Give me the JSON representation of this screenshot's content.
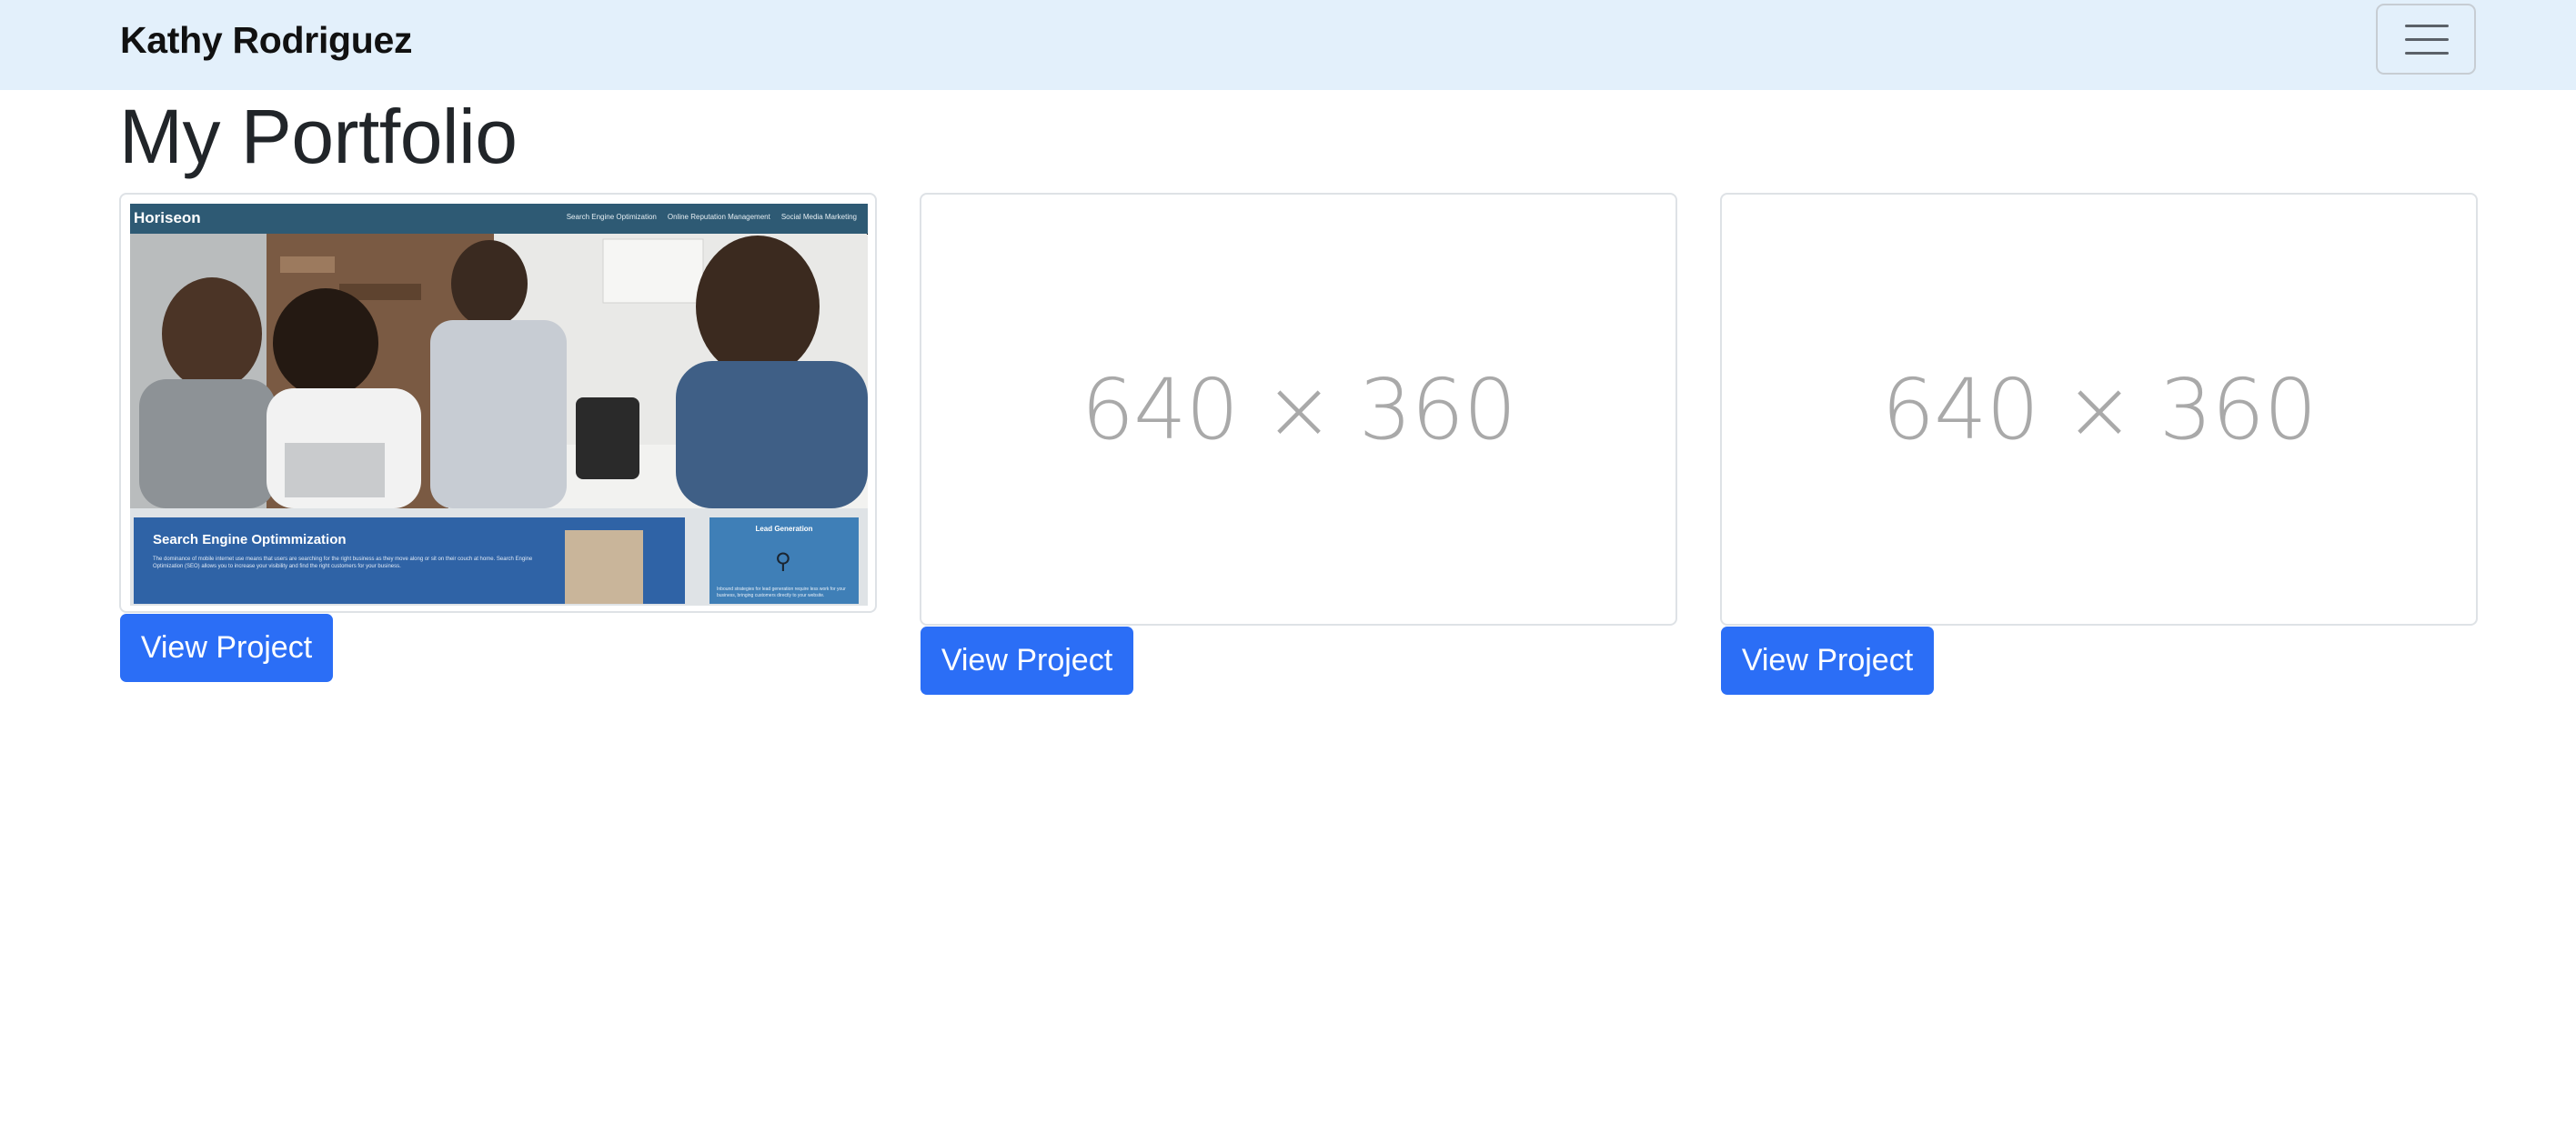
{
  "navbar": {
    "brand": "Kathy Rodriguez",
    "toggler_icon": "hamburger-menu-icon"
  },
  "page": {
    "title": "My Portfolio"
  },
  "projects": [
    {
      "thumbnail_type": "screenshot",
      "button_label": "View Project",
      "screenshot": {
        "logo": "Horiseon",
        "nav_links": [
          "Search Engine Optimization",
          "Online Reputation Management",
          "Social Media Marketing"
        ],
        "section_title": "Search Engine Optimmization",
        "section_text": "The dominance of mobile internet use means that users are searching for the right business as they move along or sit on their couch at home. Search Engine Optimization (SEO) allows you to increase your visibility and find the right customers for your business.",
        "side_title": "Lead Generation",
        "side_text": "Inbound strategies for lead generation require less work for your business, bringing customers directly to your website."
      }
    },
    {
      "thumbnail_type": "placeholder",
      "placeholder_text": "640 × 360",
      "button_label": "View Project"
    },
    {
      "thumbnail_type": "placeholder",
      "placeholder_text": "640 × 360",
      "button_label": "View Project"
    }
  ],
  "colors": {
    "navbar_bg": "#e3f0fb",
    "button_bg": "#2b6ef6",
    "placeholder_text": "#a9a9a9"
  }
}
